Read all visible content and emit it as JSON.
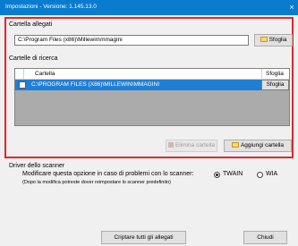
{
  "window": {
    "title": "Impostazioni - Versione: 1.145.13.0",
    "close_glyph": "×"
  },
  "attachments_section": {
    "label": "Cartella allegati",
    "path_value": "C:\\Program Files (x86)\\Millewin\\mmagini",
    "browse_label": "Sfoglia"
  },
  "search_section": {
    "label": "Cartelle di ricerca",
    "columns": {
      "folder": "Cartella",
      "browse": "Sfoglia"
    },
    "rows": [
      {
        "path": "C:\\PROGRAM FILES (X86)\\MILLEWIN\\MMAGINI",
        "browse_label": "Sfoglia",
        "checked": false,
        "selected": true
      }
    ],
    "remove_label": "Elimina cartella",
    "add_label": "Aggiungi cartella"
  },
  "scanner_section": {
    "label": "Driver dello scanner",
    "description": "Modificare questa opzione in caso di problemi con lo scanner:",
    "note": "(Dopo la modifica potreste dover reimpostare lo scanner predefinito)",
    "options": [
      {
        "label": "TWAIN",
        "selected": true
      },
      {
        "label": "WIA",
        "selected": false
      }
    ]
  },
  "footer": {
    "encrypt_label": "Criptare tutti gli allegati",
    "close_label": "Chiudi"
  },
  "colors": {
    "titlebar": "#0a7cd0",
    "highlight": "#e0262d",
    "selection": "#1f7fd7"
  },
  "icons": {
    "browse": "folder-icon",
    "add": "folder-add-icon",
    "remove": "delete-icon"
  }
}
